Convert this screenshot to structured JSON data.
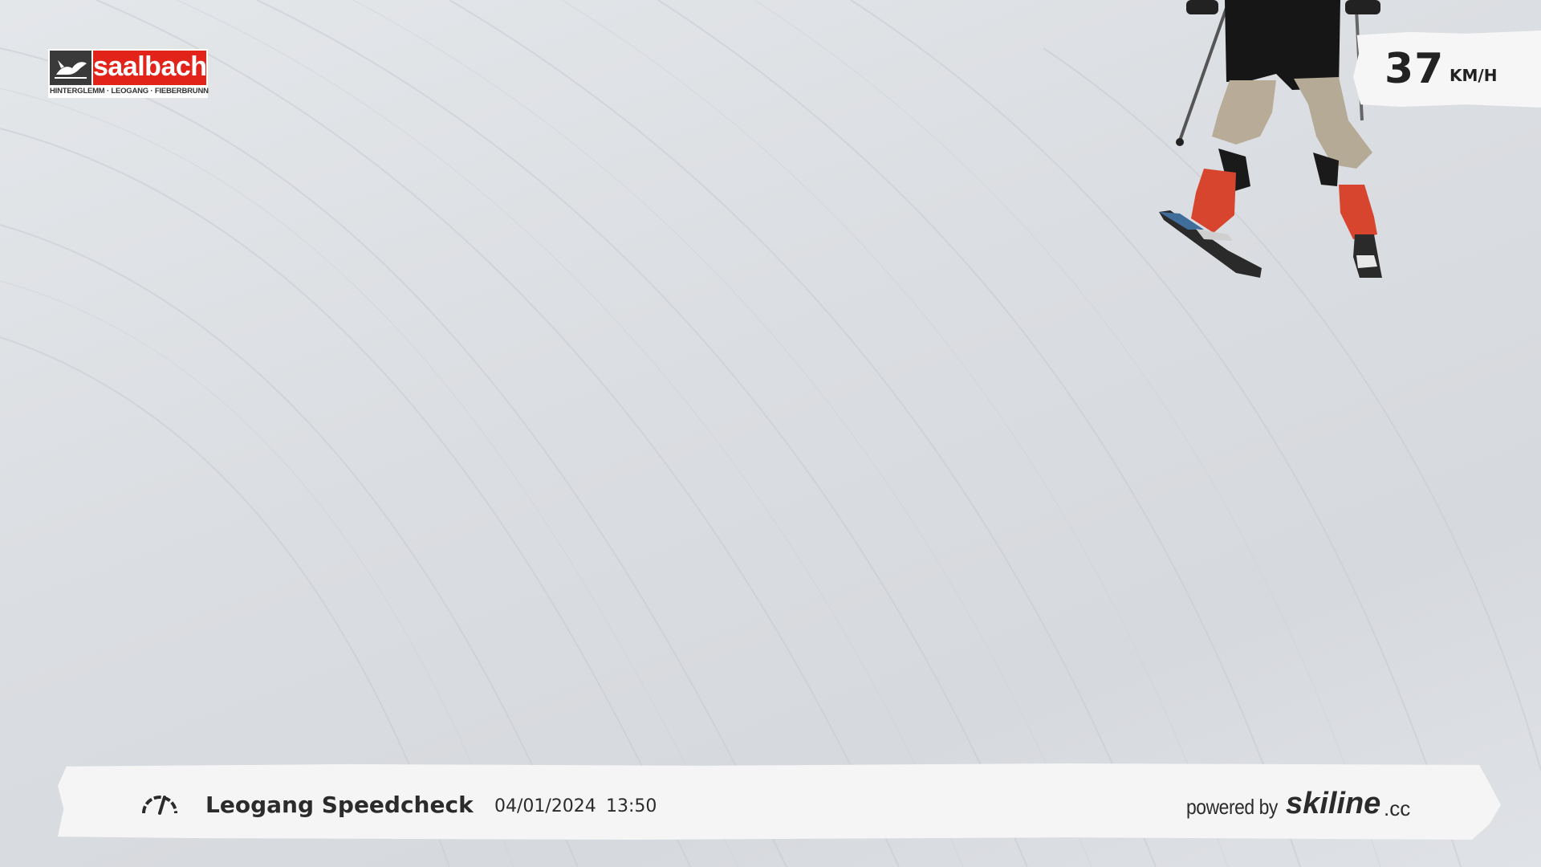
{
  "logo": {
    "wordmark": "saalbach",
    "subline": "HINTERGLEMM · LEOGANG · FIEBERBRUNN",
    "colors": {
      "red": "#e2231a",
      "dark": "#3a3a3a"
    }
  },
  "speed": {
    "value": "37",
    "unit": "KM/H"
  },
  "footer": {
    "icon": "speedometer-icon",
    "title": "Leogang Speedcheck",
    "date": "04/01/2024",
    "time": "13:50",
    "powered_by": "powered by",
    "brand": "skiline",
    "brand_tld": ".cc"
  },
  "colors": {
    "snow": "#dcdfe3",
    "banner": "#f5f5f5",
    "text": "#2b2b2b"
  }
}
